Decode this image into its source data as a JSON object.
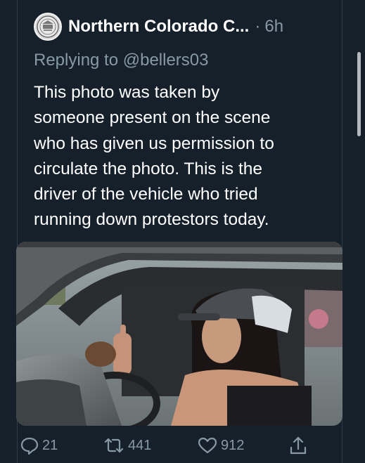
{
  "tweet": {
    "author_name": "Northern Colorado C...",
    "separator": "·",
    "time": "6h",
    "reply_to": "Replying to @bellers03",
    "text_lines": [
      "This photo was taken by",
      "someone present on the scene",
      "who has given us permission to",
      "circulate the photo. This is the",
      "driver of the vehicle who tried",
      "running down protestors today."
    ]
  },
  "actions": {
    "reply_count": "21",
    "retweet_count": "441",
    "like_count": "912"
  },
  "icons": {
    "avatar": "organization-seal-icon",
    "reply": "speech-bubble-icon",
    "retweet": "retweet-arrows-icon",
    "like": "heart-icon",
    "share": "share-upload-icon"
  },
  "colors": {
    "background": "#15202b",
    "secondary_text": "#8899a6",
    "primary_text": "#ffffff"
  }
}
